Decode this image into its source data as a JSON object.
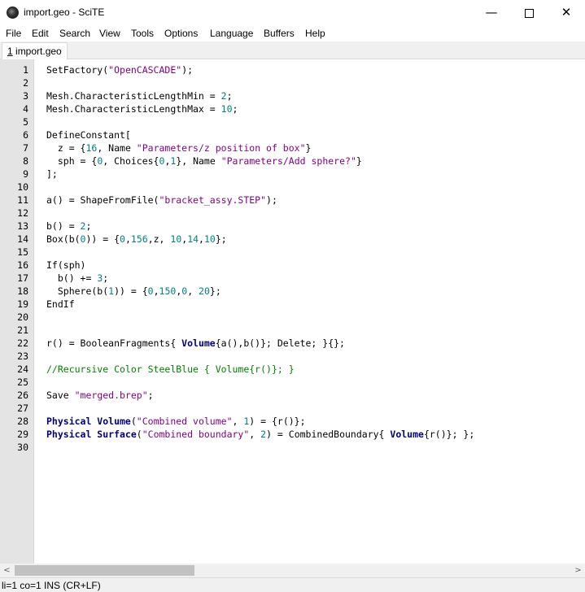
{
  "window": {
    "title": "import.geo - SciTE",
    "min_glyph": "—",
    "close_glyph": "✕"
  },
  "menu": [
    "File",
    "Edit",
    "Search",
    "View",
    "Tools",
    "Options",
    "Language",
    "Buffers",
    "Help"
  ],
  "tab": {
    "number": "1",
    "name": " import.geo"
  },
  "code_lines": [
    [
      [
        "t",
        "SetFactory("
      ],
      [
        "s",
        "\"OpenCASCADE\""
      ],
      [
        "t",
        ");"
      ]
    ],
    [],
    [
      [
        "t",
        "Mesh.CharacteristicLengthMin = "
      ],
      [
        "n",
        "2"
      ],
      [
        "t",
        ";"
      ]
    ],
    [
      [
        "t",
        "Mesh.CharacteristicLengthMax = "
      ],
      [
        "n",
        "10"
      ],
      [
        "t",
        ";"
      ]
    ],
    [],
    [
      [
        "t",
        "DefineConstant["
      ]
    ],
    [
      [
        "t",
        "  z = {"
      ],
      [
        "n",
        "16"
      ],
      [
        "t",
        ", Name "
      ],
      [
        "s",
        "\"Parameters/z position of box\""
      ],
      [
        "t",
        "}"
      ]
    ],
    [
      [
        "t",
        "  sph = {"
      ],
      [
        "n",
        "0"
      ],
      [
        "t",
        ", Choices{"
      ],
      [
        "n",
        "0"
      ],
      [
        "t",
        ","
      ],
      [
        "n",
        "1"
      ],
      [
        "t",
        "}, Name "
      ],
      [
        "s",
        "\"Parameters/Add sphere?\""
      ],
      [
        "t",
        "}"
      ]
    ],
    [
      [
        "t",
        "];"
      ]
    ],
    [],
    [
      [
        "t",
        "a() = ShapeFromFile("
      ],
      [
        "s",
        "\"bracket_assy.STEP\""
      ],
      [
        "t",
        ");"
      ]
    ],
    [],
    [
      [
        "t",
        "b() = "
      ],
      [
        "n",
        "2"
      ],
      [
        "t",
        ";"
      ]
    ],
    [
      [
        "t",
        "Box(b("
      ],
      [
        "n",
        "0"
      ],
      [
        "t",
        ")) = {"
      ],
      [
        "n",
        "0"
      ],
      [
        "t",
        ","
      ],
      [
        "n",
        "156"
      ],
      [
        "t",
        ",z, "
      ],
      [
        "n",
        "10"
      ],
      [
        "t",
        ","
      ],
      [
        "n",
        "14"
      ],
      [
        "t",
        ","
      ],
      [
        "n",
        "10"
      ],
      [
        "t",
        "};"
      ]
    ],
    [],
    [
      [
        "t",
        "If(sph)"
      ]
    ],
    [
      [
        "t",
        "  b() += "
      ],
      [
        "n",
        "3"
      ],
      [
        "t",
        ";"
      ]
    ],
    [
      [
        "t",
        "  Sphere(b("
      ],
      [
        "n",
        "1"
      ],
      [
        "t",
        ")) = {"
      ],
      [
        "n",
        "0"
      ],
      [
        "t",
        ","
      ],
      [
        "n",
        "150"
      ],
      [
        "t",
        ","
      ],
      [
        "n",
        "0"
      ],
      [
        "t",
        ", "
      ],
      [
        "n",
        "20"
      ],
      [
        "t",
        "};"
      ]
    ],
    [
      [
        "t",
        "EndIf"
      ]
    ],
    [],
    [],
    [
      [
        "t",
        "r() = BooleanFragments{ "
      ],
      [
        "k",
        "Volume"
      ],
      [
        "t",
        "{a(),b()}; Delete; }{};"
      ]
    ],
    [],
    [
      [
        "c",
        "//Recursive Color SteelBlue { Volume{r()}; }"
      ]
    ],
    [],
    [
      [
        "t",
        "Save "
      ],
      [
        "s",
        "\"merged.brep\""
      ],
      [
        "t",
        ";"
      ]
    ],
    [],
    [
      [
        "k",
        "Physical Volume"
      ],
      [
        "t",
        "("
      ],
      [
        "s",
        "\"Combined volume\""
      ],
      [
        "t",
        ", "
      ],
      [
        "n",
        "1"
      ],
      [
        "t",
        ") = {r()};"
      ]
    ],
    [
      [
        "k",
        "Physical Surface"
      ],
      [
        "t",
        "("
      ],
      [
        "s",
        "\"Combined boundary\""
      ],
      [
        "t",
        ", "
      ],
      [
        "n",
        "2"
      ],
      [
        "t",
        ") = CombinedBoundary{ "
      ],
      [
        "k",
        "Volume"
      ],
      [
        "t",
        "{r()}; };"
      ]
    ],
    []
  ],
  "scrollbar": {
    "left_arrow": "<",
    "right_arrow": ">"
  },
  "status": "li=1 co=1 INS (CR+LF)"
}
